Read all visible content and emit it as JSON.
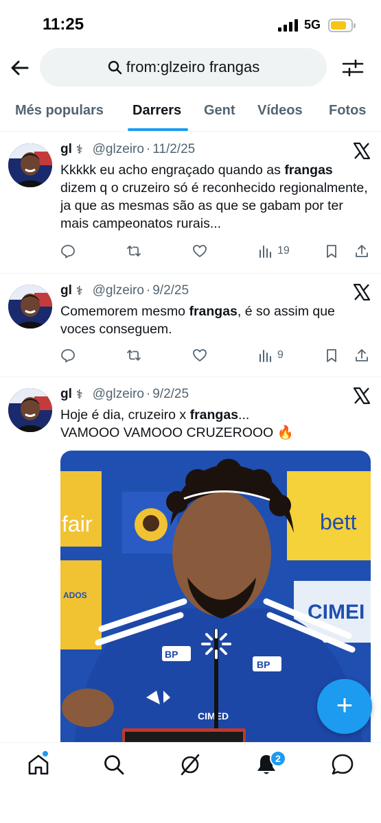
{
  "status_bar": {
    "time": "11:25",
    "network": "5G"
  },
  "search": {
    "query": "from:glzeiro frangas"
  },
  "tabs": [
    {
      "label": "Més populars",
      "active": false
    },
    {
      "label": "Darrers",
      "active": true
    },
    {
      "label": "Gent",
      "active": false
    },
    {
      "label": "Vídeos",
      "active": false
    },
    {
      "label": "Fotos",
      "active": false
    }
  ],
  "tweets": [
    {
      "name": "gl",
      "badge": "⚕",
      "handle": "@glzeiro",
      "separator": "·",
      "date": "11/2/25",
      "text_parts": [
        "Kkkkk eu acho engraçado quando as ",
        "frangas",
        " dizem q o cruzeiro só é reconhecido regionalmente, ja que as mesmas são as que se gabam por ter mais campeonatos rurais..."
      ],
      "views": "19"
    },
    {
      "name": "gl",
      "badge": "⚕",
      "handle": "@glzeiro",
      "separator": "·",
      "date": "9/2/25",
      "text_parts": [
        "Comemorem mesmo ",
        "frangas",
        ", é so assim que voces conseguem."
      ],
      "views": "9"
    },
    {
      "name": "gl",
      "badge": "⚕",
      "handle": "@glzeiro",
      "separator": "·",
      "date": "9/2/25",
      "text_parts": [
        "Hoje é dia, cruzeiro x ",
        "frangas",
        "..."
      ],
      "text_line2": "VAMOOO VAMOOO CRUZEROOO 🔥"
    }
  ],
  "media": {
    "sponsor_left": "fair",
    "sponsor_right": "bett",
    "sponsor_cimed": "CIMEI",
    "board_text": "ADOS",
    "shirt_sponsor": "CIMED",
    "shirt_badge": "BP"
  },
  "fab": {
    "label": "+"
  },
  "bottom_nav": {
    "notifications_count": "2"
  },
  "colors": {
    "accent": "#1d9bf0",
    "text": "#0f1419",
    "muted": "#536471"
  }
}
